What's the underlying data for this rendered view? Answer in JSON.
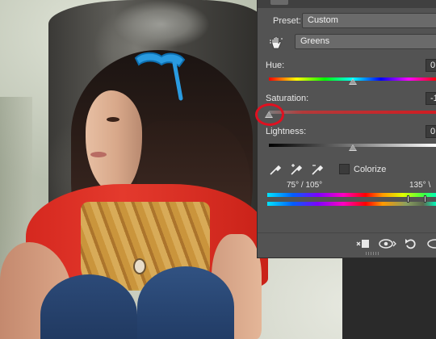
{
  "panel": {
    "preset_label": "Preset:",
    "preset_value": "Custom",
    "channel_value": "Greens",
    "hue_label": "Hue:",
    "hue_value": "0",
    "hue_position": 0.5,
    "saturation_label": "Saturation:",
    "saturation_value": "-1",
    "saturation_position": 0.0,
    "lightness_label": "Lightness:",
    "lightness_value": "0",
    "lightness_position": 0.5,
    "colorize_label": "Colorize",
    "colorize_checked": false,
    "range_left": "75° / 105°",
    "range_right": "135° \\",
    "icons": [
      "hand-scrubby-icon",
      "eyedropper-icon",
      "eyedropper-plus-icon",
      "eyedropper-minus-icon",
      "clip-to-layer-icon",
      "view-previous-icon",
      "reset-icon",
      "visibility-icon"
    ]
  },
  "colors": {
    "panel_bg": "#535353",
    "highlight_ring": "#e01020",
    "saturation_track": "#c8242a"
  }
}
